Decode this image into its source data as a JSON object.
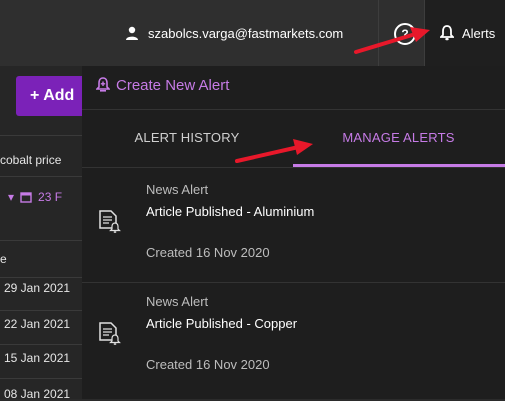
{
  "header": {
    "user_email": "szabolcs.varga@fastmarkets.com",
    "help_label": "?",
    "alerts_label": "Alerts"
  },
  "background": {
    "add_label": "+ Add",
    "search_text": "cobalt price",
    "date_filter": "23 F",
    "column_header": "e",
    "dates": [
      "29 Jan 2021",
      "22 Jan 2021",
      "15 Jan 2021",
      "08 Jan 2021"
    ]
  },
  "panel": {
    "create_label": "Create New Alert",
    "tabs": [
      {
        "label": "ALERT HISTORY",
        "active": false
      },
      {
        "label": "MANAGE ALERTS",
        "active": true
      }
    ],
    "alerts": [
      {
        "type": "News Alert",
        "title": "Article Published - Aluminium",
        "created": "Created 16 Nov 2020"
      },
      {
        "type": "News Alert",
        "title": "Article Published - Copper",
        "created": "Created 16 Nov 2020"
      }
    ]
  },
  "colors": {
    "accent": "#c67be6",
    "button": "#7b22b8",
    "annotation_arrow": "#e8182a"
  },
  "icons": [
    "user-icon",
    "help-icon",
    "bell-icon",
    "bell-plus-icon",
    "calendar-icon",
    "document-bell-icon",
    "red-arrow-annotation"
  ]
}
